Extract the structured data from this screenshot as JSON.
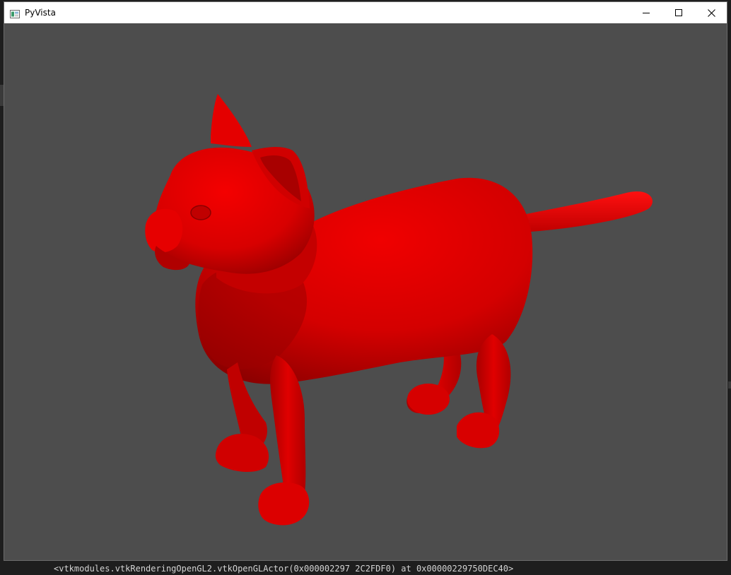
{
  "window": {
    "title": "PyVista",
    "icons": {
      "app": "app-window-icon",
      "minimize": "minimize-icon",
      "maximize": "maximize-icon",
      "close": "close-icon"
    }
  },
  "viewport": {
    "background_color": "#4d4d4d",
    "model_color": "#ff0000"
  },
  "console": {
    "line": "<vtkmodules.vtkRenderingOpenGL2.vtkOpenGLActor(0x000002297 2C2FDF0) at 0x00000229750DEC40>"
  }
}
